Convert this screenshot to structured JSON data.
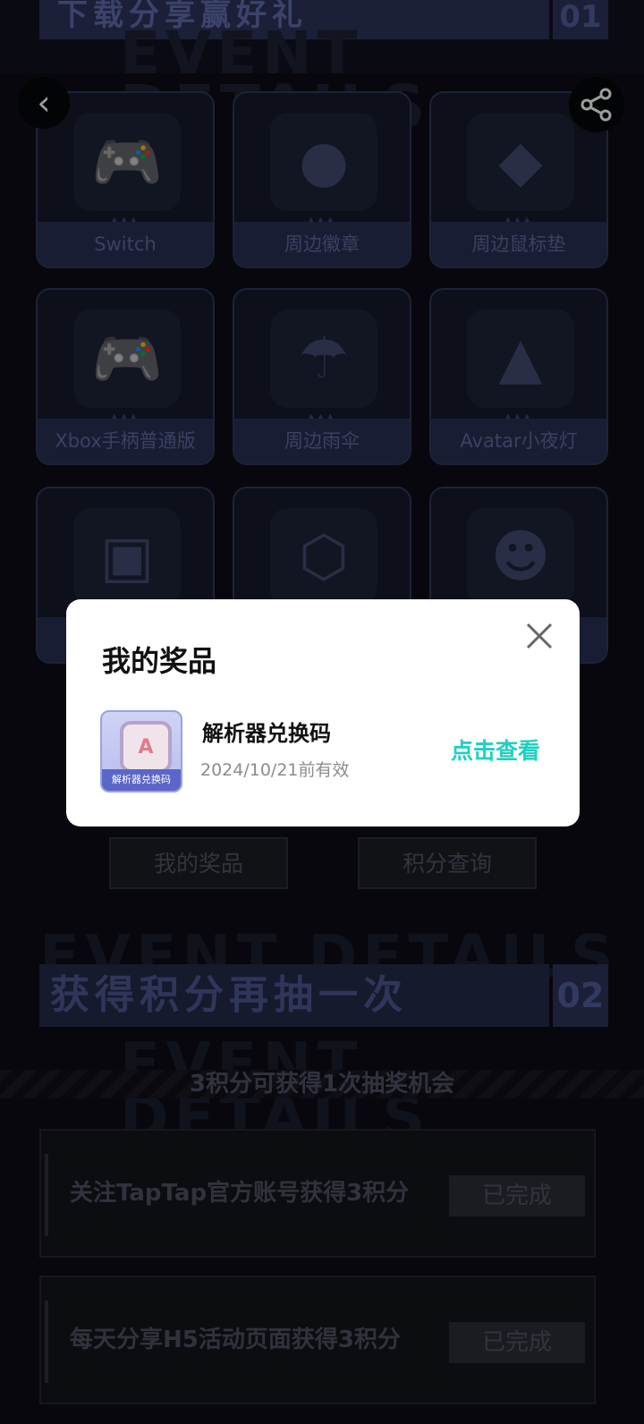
{
  "header": {
    "banner_title": "下载分享赢好礼",
    "banner_num": "01",
    "ghost_text": "EVENT DETAILS"
  },
  "nav": {
    "back_glyph": "‹",
    "share_icon": "share-icon"
  },
  "prizes": [
    {
      "label": "Switch",
      "icon": "🎮"
    },
    {
      "label": "周边徽章",
      "icon": "●"
    },
    {
      "label": "周边鼠标垫",
      "icon": "◆"
    },
    {
      "label": "Xbox手柄普通版",
      "icon": "🎮"
    },
    {
      "label": "周边雨伞",
      "icon": "☂"
    },
    {
      "label": "Avatar小夜灯",
      "icon": "▲"
    },
    {
      "label": "",
      "icon": "▣"
    },
    {
      "label": "",
      "icon": "⬡"
    },
    {
      "label": "",
      "icon": "☻"
    }
  ],
  "buttons": {
    "my_prizes": "我的奖品",
    "points_query": "积分查询"
  },
  "section2": {
    "ghost_text": "EVENT DETAILS",
    "title": "获得积分再抽一次",
    "num": "02",
    "subtitle": "3积分可获得1次抽奖机会"
  },
  "tasks": [
    {
      "label": "关注TapTap官方账号获得3积分",
      "button": "已完成"
    },
    {
      "label": "每天分享H5活动页面获得3积分",
      "button": "已完成"
    }
  ],
  "modal": {
    "title": "我的奖品",
    "close_icon": "close-icon",
    "prize": {
      "thumb_tag": "解析器兑换码",
      "name": "解析器兑换码",
      "valid": "2024/10/21前有效",
      "action": "点击查看"
    }
  }
}
